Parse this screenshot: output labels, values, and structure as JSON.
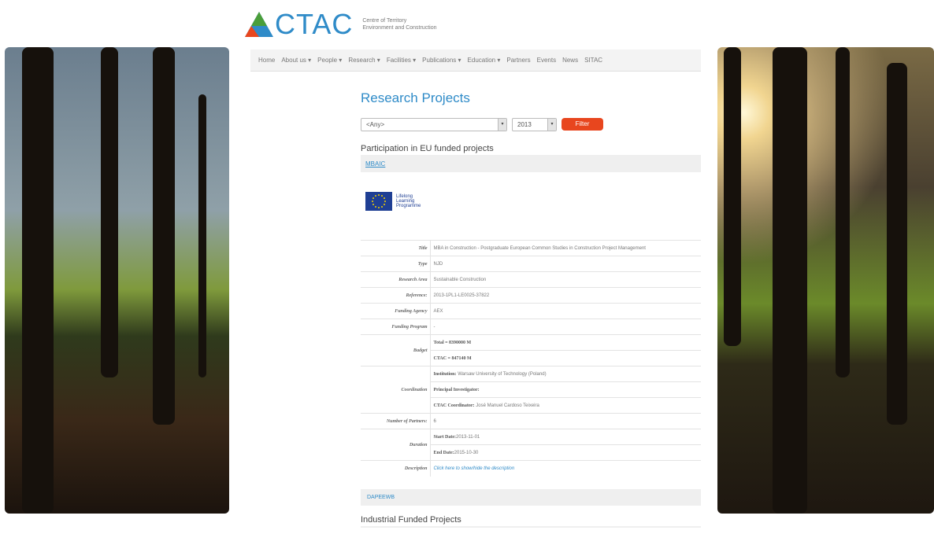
{
  "brand": {
    "name": "CTAC",
    "subtitle_line1": "Centre of Territory",
    "subtitle_line2": "Environment and Construction",
    "colors": {
      "blue": "#2f8bc8",
      "orange": "#e8461e",
      "green": "#4a9e3a"
    }
  },
  "nav": {
    "items": [
      "Home",
      "About us ▾",
      "People ▾",
      "Research ▾",
      "Facilities ▾",
      "Publications ▾",
      "Education ▾",
      "Partners",
      "Events",
      "News",
      "SITAC"
    ]
  },
  "main": {
    "title": "Research Projects",
    "filter": {
      "area_value": "<Any>",
      "year_value": "2013",
      "button_label": "Filter"
    },
    "eu_section_title": "Participation in EU funded projects",
    "project1_link": "MBAIC",
    "eu_logo_text": [
      "Lifelong",
      "Learning",
      "Programme"
    ],
    "details": {
      "title_label": "Title",
      "title_value": "MBA in Construction - Postgraduate European Common Studies in Construction Project Management",
      "type_label": "Type",
      "type_value": "NJD",
      "area_label": "Research Area",
      "area_value": "Sustainable Construction",
      "reference_label": "Reference:",
      "reference_value": "2013-1PL1-LE0025-37822",
      "agency_label": "Funding Agency",
      "agency_value": "AEX",
      "program_label": "Funding Program",
      "program_value": "-",
      "budget_label": "Budget",
      "budget_total": "Total = 8390000 M",
      "budget_ctac": "CTAC = 847140 M",
      "coordination_label": "Coordination",
      "institution_label": "Institution:",
      "institution_value": "Warsaw University of Technology (Poland)",
      "pi_label": "Principal Investigator:",
      "ctac_coord_label": "CTAC Coordinator:",
      "ctac_coord_value": "José Manuel Cardoso Teixeira",
      "partners_label": "Number of Partners:",
      "partners_value": "6",
      "duration_label": "Duration",
      "start_label": "Start Date:",
      "start_value": "2013-11-01",
      "end_label": "End Date:",
      "end_value": "2015-10-30",
      "description_label": "Description",
      "description_link": "Click here to show/hide the description"
    },
    "project2_link": "DAPEEWB",
    "industrial_title": "Industrial Funded Projects"
  }
}
